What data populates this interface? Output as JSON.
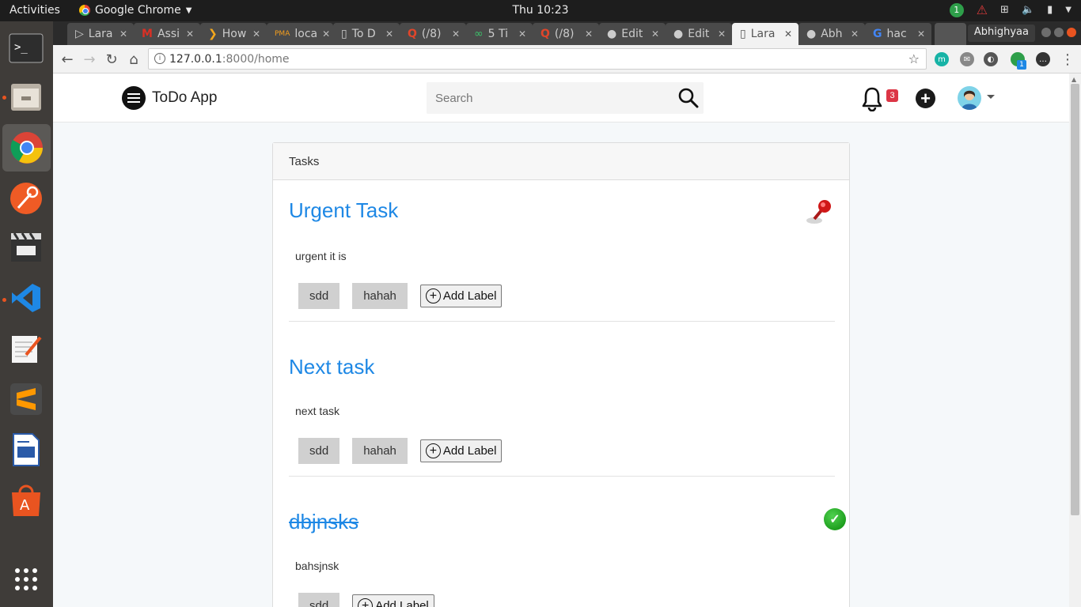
{
  "system": {
    "activities": "Activities",
    "app_name": "Google Chrome",
    "clock": "Thu 10:23",
    "notification_count": "1"
  },
  "dock": [
    "terminal-icon",
    "files-icon",
    "chrome-icon",
    "postman-icon",
    "video-editor-icon",
    "vscode-icon",
    "text-editor-icon",
    "sublime-icon",
    "writer-icon",
    "software-center-icon",
    "app-grid-icon"
  ],
  "browser": {
    "tabs": [
      "Lara",
      "Assi",
      "How",
      "loca",
      "To D",
      "(/8)",
      "5 Ti",
      "(/8)",
      "Edit",
      "Edit",
      "Lara",
      "Abh",
      "hac"
    ],
    "active_tab_index": 10,
    "profile_name": "Abhighyaa",
    "url_host": "127.0.0.1",
    "url_path": ":8000/home",
    "extension_badge": "1"
  },
  "app": {
    "brand": "ToDo App",
    "search_placeholder": "Search",
    "notification_badge": "3"
  },
  "card": {
    "header": "Tasks",
    "add_label_text": "Add Label",
    "tasks": [
      {
        "title": "Urgent Task",
        "description": "urgent it is",
        "labels": [
          "sdd",
          "hahah"
        ],
        "pinned": true,
        "completed": false
      },
      {
        "title": "Next task",
        "description": "next task",
        "labels": [
          "sdd",
          "hahah"
        ],
        "pinned": false,
        "completed": false
      },
      {
        "title": "dbjnsks",
        "description": "bahsjnsk",
        "labels": [
          "sdd"
        ],
        "pinned": false,
        "completed": true
      }
    ]
  },
  "colors": {
    "link": "#1e88e5",
    "badge": "#dc3545",
    "ubuntu_orange": "#e95420"
  }
}
